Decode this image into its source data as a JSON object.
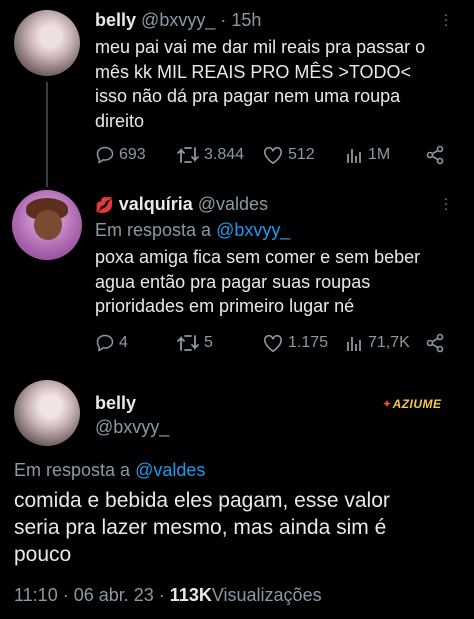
{
  "tweet1": {
    "name": "belly",
    "handle": "@bxvyy_",
    "sep": "·",
    "time": "15h",
    "lines": [
      "meu pai vai me dar mil reais pra passar o",
      "mês kk MIL REAIS PRO MÊS >TODO<",
      "isso não dá pra pagar nem uma roupa",
      "direito"
    ],
    "replies": "693",
    "retweets": "3.844",
    "likes": "512",
    "views": "1M"
  },
  "tweet2": {
    "emoji": "💋",
    "name": "valquíria",
    "handle": "@valdes",
    "reply_prefix": "Em resposta a",
    "reply_to": "@bxvyy_",
    "lines": [
      "poxa amiga fica sem comer e sem beber",
      "agua então pra pagar suas roupas",
      "prioridades em primeiro lugar né"
    ],
    "replies": "4",
    "retweets": "5",
    "likes": "1.175",
    "views": "71,7K"
  },
  "tweet3": {
    "name": "belly",
    "handle": "@bxvyy_",
    "reply_prefix": "Em resposta a",
    "reply_to": "@valdes",
    "lines": [
      "comida e bebida eles pagam, esse valor",
      "seria pra lazer mesmo, mas ainda sim é",
      "pouco"
    ],
    "timestamp": "11:10 · 06 abr. 23 ·",
    "views_count": "113K",
    "views_label": "Visualizações"
  },
  "watermark": "AZIUME",
  "icons": [
    "reply-icon",
    "retweet-icon",
    "like-icon",
    "views-icon",
    "share-icon",
    "more-icon"
  ],
  "colors": {
    "background": "#000000",
    "text": "#e7e9ea",
    "muted": "#8b98a5",
    "link": "#1d9bf0"
  }
}
